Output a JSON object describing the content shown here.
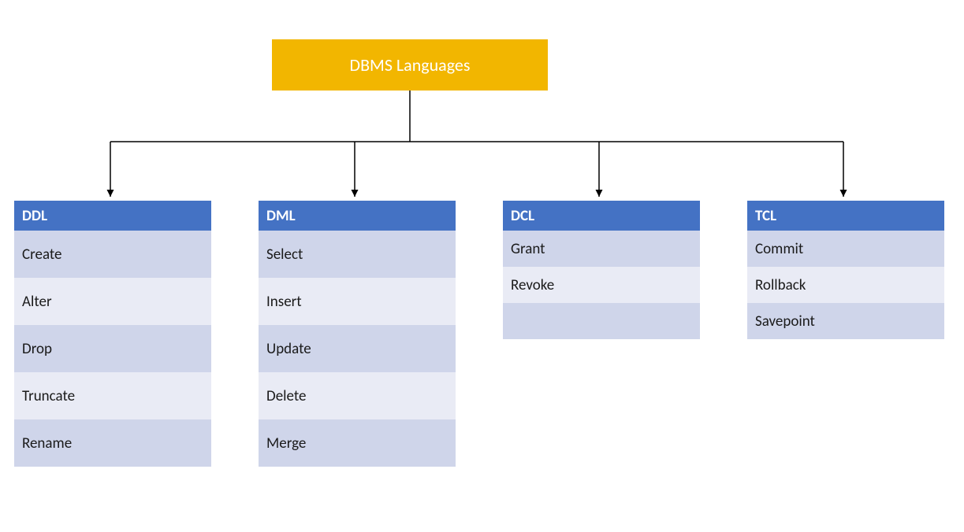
{
  "root": {
    "label": "DBMS Languages"
  },
  "columns": [
    {
      "header": "DDL",
      "items": [
        "Create",
        "Alter",
        "Drop",
        "Truncate",
        "Rename"
      ],
      "big": true,
      "pad": 0
    },
    {
      "header": "DML",
      "items": [
        "Select",
        "Insert",
        "Update",
        "Delete",
        "Merge"
      ],
      "big": true,
      "pad": 0
    },
    {
      "header": "DCL",
      "items": [
        "Grant",
        "Revoke"
      ],
      "big": false,
      "pad": 1
    },
    {
      "header": "TCL",
      "items": [
        "Commit",
        "Rollback",
        "Savepoint"
      ],
      "big": false,
      "pad": 0
    }
  ],
  "colors": {
    "root_bg": "#F2B600",
    "header_bg": "#4472C4",
    "row_a": "#CFD5EA",
    "row_b": "#E9EBF5"
  }
}
